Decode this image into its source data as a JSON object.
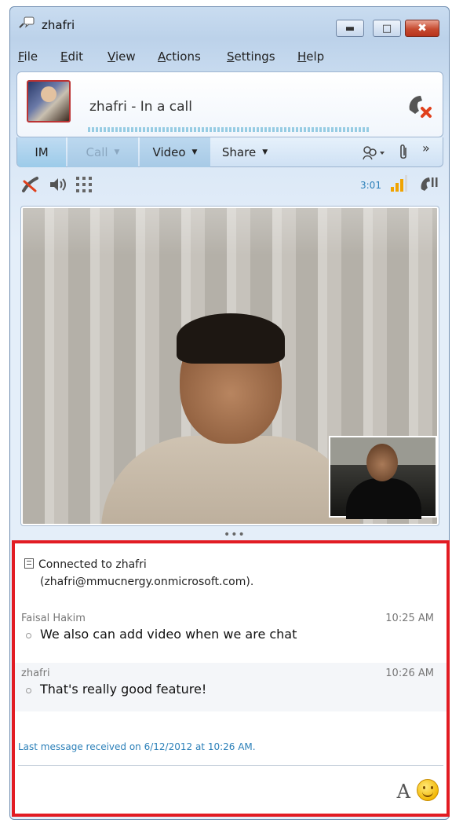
{
  "window": {
    "title": "zhafri"
  },
  "menu": {
    "items": [
      "File",
      "Edit",
      "View",
      "Actions",
      "Settings",
      "Help"
    ]
  },
  "header": {
    "contact_status": "zhafri - In a call"
  },
  "tabs": {
    "im": "IM",
    "call": "Call",
    "video": "Video",
    "share": "Share",
    "more": "»"
  },
  "controls": {
    "duration": "3:01"
  },
  "conversation": {
    "connected_line1": "Connected to zhafri",
    "connected_line2": "(zhafri@mmucnergy.onmicrosoft.com).",
    "messages": [
      {
        "sender": "Faisal Hakim",
        "time": "10:25 AM",
        "text": "We also can add video when we are chat"
      },
      {
        "sender": "zhafri",
        "time": "10:26 AM",
        "text": "That's really good feature!"
      }
    ],
    "last_received": "Last message received on 6/12/2012 at 10:26 AM.",
    "font_button": "A"
  },
  "colors": {
    "highlight_border": "#e21c23",
    "link_blue": "#2a7fb8"
  }
}
